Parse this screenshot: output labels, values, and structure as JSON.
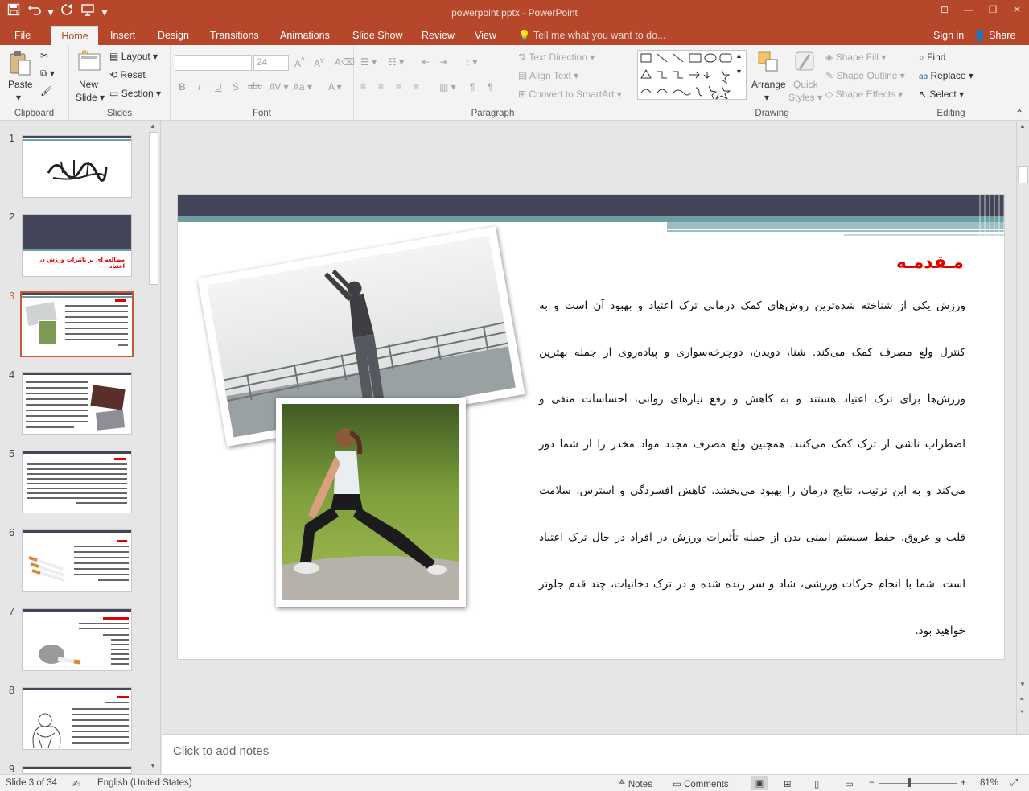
{
  "window": {
    "title": "powerpoint.pptx - PowerPoint",
    "qat": [
      "save-icon",
      "undo-icon",
      "undo-dropdown",
      "redo-icon",
      "present-icon",
      "customize-icon"
    ]
  },
  "tabs": [
    "File",
    "Home",
    "Insert",
    "Design",
    "Transitions",
    "Animations",
    "Slide Show",
    "Review",
    "View"
  ],
  "active_tab": "Home",
  "tell_me": "Tell me what you want to do...",
  "signin": "Sign in",
  "share": "Share",
  "ribbon": {
    "clipboard": {
      "label": "Clipboard",
      "paste": "Paste"
    },
    "slides": {
      "label": "Slides",
      "new_slide_1": "New",
      "new_slide_2": "Slide",
      "layout": "Layout",
      "reset": "Reset",
      "section": "Section"
    },
    "font": {
      "label": "Font",
      "font_size": "24",
      "bold": "B",
      "italic": "I",
      "underline": "U",
      "shadow": "S",
      "strike": "abc",
      "case": "Aa"
    },
    "paragraph": {
      "label": "Paragraph",
      "text_direction": "Text Direction",
      "align_text": "Align Text",
      "smartart": "Convert to SmartArt"
    },
    "drawing": {
      "label": "Drawing",
      "arrange": "Arrange",
      "quick_styles_1": "Quick",
      "quick_styles_2": "Styles",
      "shape_fill": "Shape Fill",
      "shape_outline": "Shape Outline",
      "shape_effects": "Shape Effects"
    },
    "editing": {
      "label": "Editing",
      "find": "Find",
      "replace": "Replace",
      "select": "Select"
    }
  },
  "thumbnails": [
    {
      "num": "1"
    },
    {
      "num": "2",
      "caption": "مطالعه ای بر تاثیرات ورزش در اعتیاد"
    },
    {
      "num": "3"
    },
    {
      "num": "4"
    },
    {
      "num": "5"
    },
    {
      "num": "6"
    },
    {
      "num": "7"
    },
    {
      "num": "8"
    },
    {
      "num": "9"
    }
  ],
  "selected_slide": 3,
  "slide": {
    "heading": "مـقدمـه",
    "lines": [
      "ورزش یکی از شناخته شده‌ترین روش‌های کمک درمانی ترک اعتیاد و بهبود آن است و به",
      "کنترل ولع مصرف کمک می‌کند. شنا، دویدن، دوچرخه‌سواری و پیاده‌روی از جمله بهترین",
      "ورزش‌ها برای ترک اعتیاد هستند و به کاهش و رفع نیازهای روانی، احساسات منفی و",
      "اضطراب ناشی از ترک کمک می‌کنند. همچنین ولع مصرف مجدد مواد مخدر را از شما دور",
      "می‌کند و به این ترتیب، نتایج درمان را بهبود می‌بخشد. کاهش افسردگی و استرس، سلامت",
      "قلب و عروق، حفظ سیستم ایمنی بدن از جمله تأثیرات ورزش در افراد در حال ترک اعتیاد",
      "است. شما با انجام حرکات ورزشی، شاد و سر زنده شده و در ترک دخانیات، چند قدم جلوتر",
      "خواهید بود."
    ],
    "colors": {
      "header_bar": "#444559",
      "teal": "#6b9fa4",
      "heading": "#e00000"
    }
  },
  "notes_placeholder": "Click to add notes",
  "status": {
    "slide_info": "Slide 3 of 34",
    "language": "English (United States)",
    "notes": "Notes",
    "comments": "Comments",
    "zoom": "81%"
  }
}
